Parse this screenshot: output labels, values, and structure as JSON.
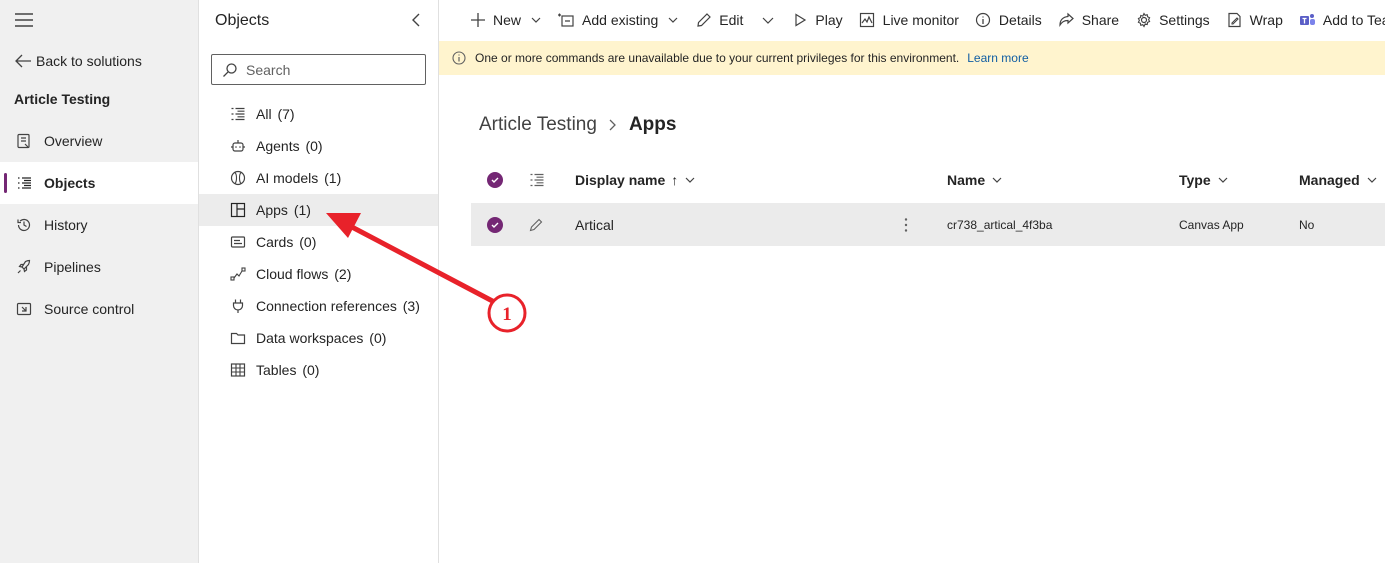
{
  "left_nav": {
    "back_label": "Back to solutions",
    "solution_title": "Article Testing",
    "items": [
      {
        "label": "Overview",
        "icon": "overview-icon"
      },
      {
        "label": "Objects",
        "icon": "objects-icon",
        "selected": true
      },
      {
        "label": "History",
        "icon": "history-icon"
      },
      {
        "label": "Pipelines",
        "icon": "rocket-icon"
      },
      {
        "label": "Source control",
        "icon": "source-control-icon"
      }
    ]
  },
  "objects_panel": {
    "title": "Objects",
    "search_placeholder": "Search",
    "items": [
      {
        "label": "All",
        "count": "(7)",
        "icon": "list-icon"
      },
      {
        "label": "Agents",
        "count": "(0)",
        "icon": "agent-icon"
      },
      {
        "label": "AI models",
        "count": "(1)",
        "icon": "ai-model-icon"
      },
      {
        "label": "Apps",
        "count": "(1)",
        "icon": "apps-icon",
        "selected": true
      },
      {
        "label": "Cards",
        "count": "(0)",
        "icon": "card-icon"
      },
      {
        "label": "Cloud flows",
        "count": "(2)",
        "icon": "flow-icon"
      },
      {
        "label": "Connection references",
        "count": "(3)",
        "icon": "plug-icon"
      },
      {
        "label": "Data workspaces",
        "count": "(0)",
        "icon": "folder-icon"
      },
      {
        "label": "Tables",
        "count": "(0)",
        "icon": "table-icon"
      }
    ]
  },
  "command_bar": {
    "new": "New",
    "add_existing": "Add existing",
    "edit": "Edit",
    "play": "Play",
    "live_monitor": "Live monitor",
    "details": "Details",
    "share": "Share",
    "settings": "Settings",
    "wrap": "Wrap",
    "add_to_teams": "Add to Tear"
  },
  "banner": {
    "message": "One or more commands are unavailable due to your current privileges for this environment.",
    "link": "Learn more"
  },
  "breadcrumb": {
    "parent": "Article Testing",
    "current": "Apps"
  },
  "grid": {
    "columns": {
      "display_name": "Display name",
      "sort_arrow": "↑",
      "name": "Name",
      "type": "Type",
      "managed": "Managed"
    },
    "rows": [
      {
        "display_name": "Artical",
        "name": "cr738_artical_4f3ba",
        "type": "Canvas App",
        "managed": "No"
      }
    ]
  },
  "annotation": {
    "number": "1",
    "color": "#e8222a"
  },
  "colors": {
    "accent": "#742774",
    "banner_bg": "#fff4ce",
    "link": "#115ea3"
  }
}
